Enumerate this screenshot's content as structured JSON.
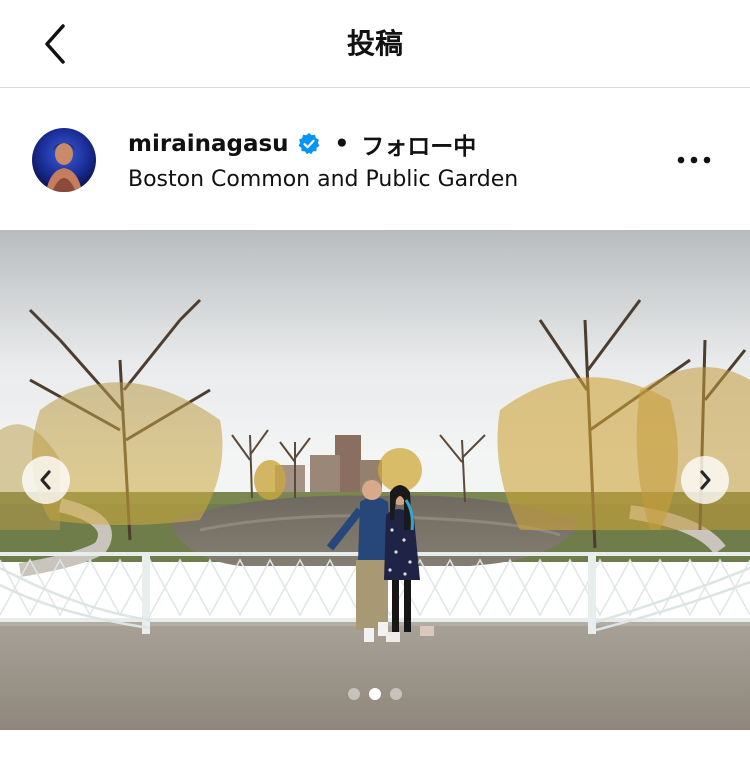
{
  "topbar": {
    "title": "投稿",
    "back_icon": "chevron-left-icon"
  },
  "post": {
    "username": "mirainagasu",
    "verified": true,
    "separator": "•",
    "follow_status": "フォロー中",
    "location": "Boston Common and Public Garden",
    "more_icon": "more-horizontal-icon"
  },
  "carousel": {
    "slide_count": 3,
    "active_index": 1,
    "prev_icon": "chevron-left-icon",
    "next_icon": "chevron-right-icon"
  },
  "colors": {
    "verified_badge": "#0095f6",
    "divider": "#dbdbdb",
    "text": "#111111"
  }
}
